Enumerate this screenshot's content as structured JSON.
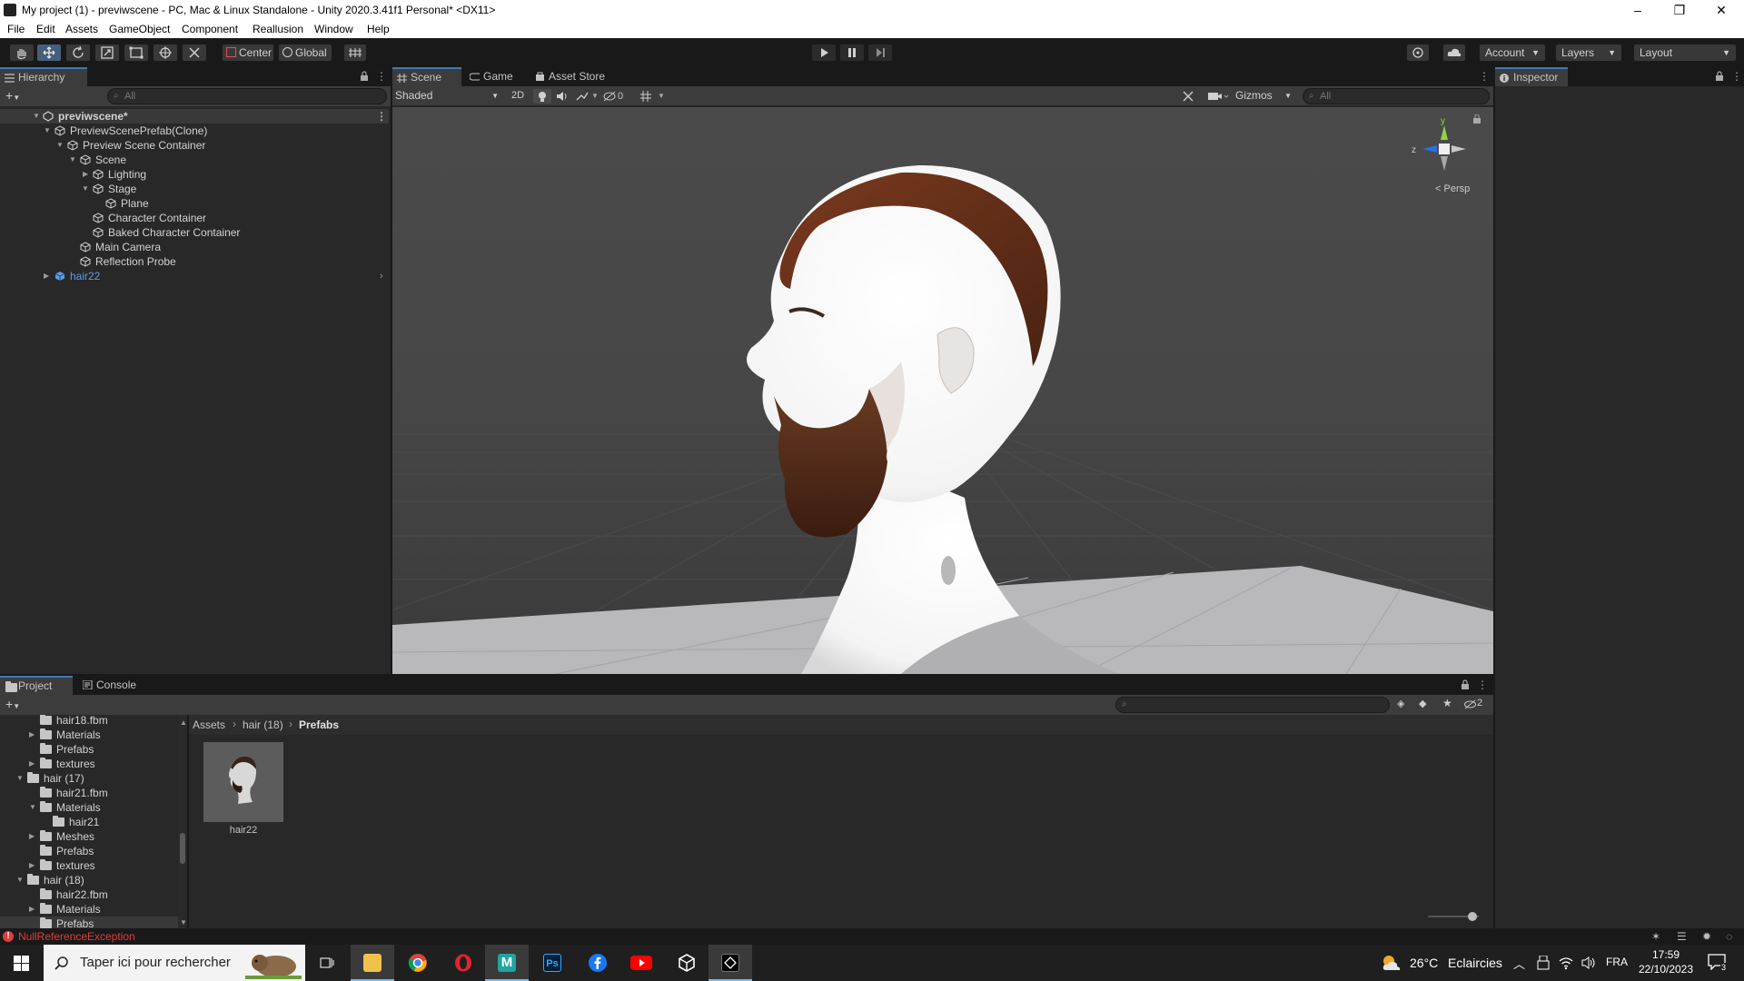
{
  "window": {
    "title": "My project (1) - previwscene - PC, Mac & Linux Standalone - Unity 2020.3.41f1 Personal* <DX11>",
    "min": "–",
    "restore": "❐",
    "close": "✕"
  },
  "menu": [
    "File",
    "Edit",
    "Assets",
    "GameObject",
    "Component",
    "Reallusion",
    "Window",
    "Help"
  ],
  "toolbar": {
    "pivot": "Center",
    "space": "Global",
    "account": "Account",
    "layers": "Layers",
    "layout": "Layout",
    "play_icon": "play-icon",
    "pause_icon": "pause-icon",
    "step_icon": "step-icon"
  },
  "hierarchy": {
    "tab": "Hierarchy",
    "search_placeholder": "All",
    "items": [
      {
        "label": "previwscene*"
      },
      {
        "label": "PreviewScenePrefab(Clone)"
      },
      {
        "label": "Preview Scene Container"
      },
      {
        "label": "Scene"
      },
      {
        "label": "Lighting"
      },
      {
        "label": "Stage"
      },
      {
        "label": "Plane"
      },
      {
        "label": "Character Container"
      },
      {
        "label": "Baked Character Container"
      },
      {
        "label": "Main Camera"
      },
      {
        "label": "Reflection Probe"
      },
      {
        "label": "hair22"
      }
    ]
  },
  "scene_tabs": [
    "Scene",
    "Game",
    "Asset Store"
  ],
  "scene_toolbar": {
    "shading": "Shaded",
    "mode_2d": "2D",
    "hidden_count": "0",
    "gizmos": "Gizmos",
    "search_placeholder": "All"
  },
  "gizmo": {
    "y": "y",
    "z": "z",
    "persp": "Persp"
  },
  "inspector": {
    "tab": "Inspector"
  },
  "project": {
    "tabs": [
      "Project",
      "Console"
    ],
    "tree": [
      {
        "label": "hair18.fbm"
      },
      {
        "label": "Materials"
      },
      {
        "label": "Prefabs"
      },
      {
        "label": "textures"
      },
      {
        "label": "hair (17)"
      },
      {
        "label": "hair21.fbm"
      },
      {
        "label": "Materials"
      },
      {
        "label": "hair21"
      },
      {
        "label": "Meshes"
      },
      {
        "label": "Prefabs"
      },
      {
        "label": "textures"
      },
      {
        "label": "hair (18)"
      },
      {
        "label": "hair22.fbm"
      },
      {
        "label": "Materials"
      },
      {
        "label": "Prefabs"
      }
    ],
    "breadcrumb": [
      "Assets",
      "hair (18)",
      "Prefabs"
    ],
    "asset": {
      "label": "hair22"
    },
    "hidden_count": "2"
  },
  "status": {
    "error": "NullReferenceException"
  },
  "taskbar": {
    "search_placeholder": "Taper ici pour rechercher",
    "weather_temp": "26°C",
    "weather_text": "Eclaircies",
    "lang": "FRA",
    "time": "17:59",
    "date": "22/10/2023",
    "notif_count": "3"
  },
  "colors": {
    "accent": "#3a79bb",
    "error": "#e03c3c",
    "link": "#5c9bea"
  }
}
